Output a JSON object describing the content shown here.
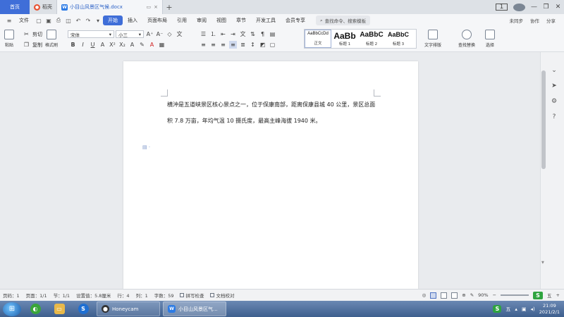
{
  "tabbar": {
    "home_label": "首页",
    "tabs": [
      {
        "label": "稻壳"
      },
      {
        "label": "小目山风景区气候.docx"
      }
    ],
    "plus": "+",
    "badge": "1",
    "minimize": "—",
    "maximize": "❐",
    "close": "✕"
  },
  "menubar": {
    "file_label": "文件",
    "items": [
      "开始",
      "插入",
      "页面布局",
      "引用",
      "审阅",
      "视图",
      "章节",
      "开发工具",
      "会员专享"
    ],
    "active_index": 0,
    "search_placeholder": "查找命令、搜索模板",
    "right": {
      "sync": "未同步",
      "collab": "协作",
      "share": "分享"
    }
  },
  "ribbon": {
    "paste": "粘贴",
    "cut": "剪切",
    "copy": "复制",
    "format_painter": "格式刷",
    "font_name": "宋体",
    "font_size": "小三",
    "styles": [
      {
        "preview": "AaBbCcDd",
        "name": "正文"
      },
      {
        "preview": "AaBb",
        "name": "标题 1"
      },
      {
        "preview": "AaBbC",
        "name": "标题 2"
      },
      {
        "preview": "AaBbC",
        "name": "标题 3"
      }
    ],
    "text_layout": "文字排版",
    "find_replace": "查找替换",
    "select": "选择"
  },
  "document": {
    "paragraph": "横沖是五道峡景区核心景点之一，位于保康南部，距离保康县城 40 公里，景区总面积 7.8 万亩，年均气温 10 摄氏度，最高主峰海拔 1940 米。"
  },
  "status": {
    "page_num": "页码：1",
    "pages": "页面：1/1",
    "section": "节：1/1",
    "position": "设置值：5.8厘米",
    "line": "行：4",
    "col": "列：1",
    "word_count": "字数：59",
    "spell_check": "拼写检查",
    "doc_check": "文档校对",
    "zoom": "90%"
  },
  "taskbar": {
    "items": [
      {
        "label": "Honeycam"
      },
      {
        "label": "小目山风景区气..."
      }
    ],
    "time": "21:09",
    "date": "2021/2/1",
    "ime": "五"
  }
}
